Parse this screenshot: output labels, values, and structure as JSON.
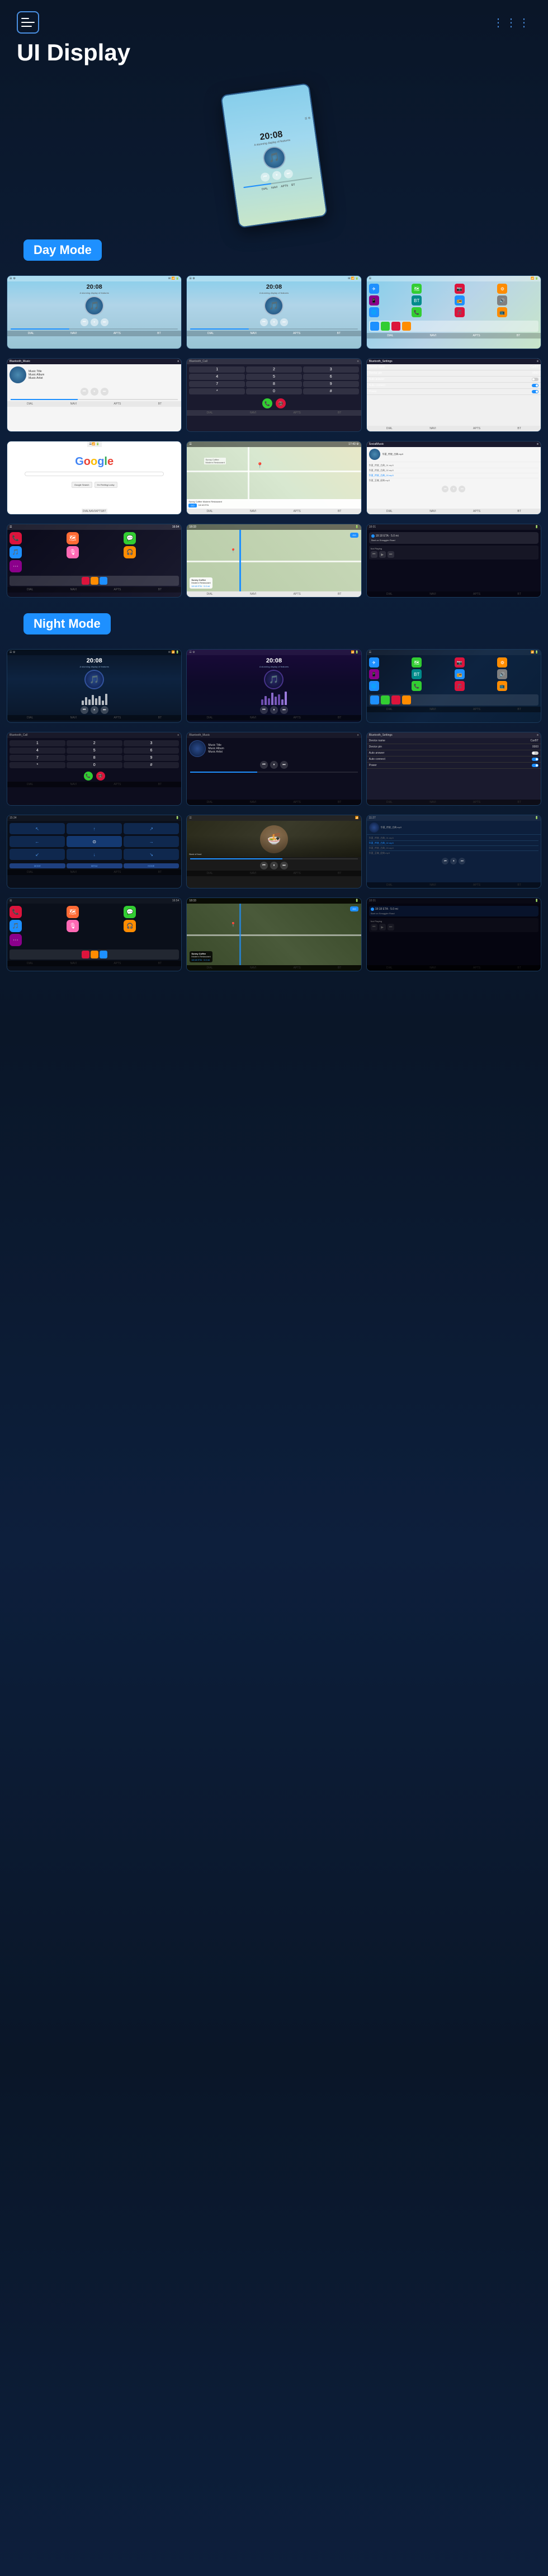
{
  "header": {
    "title": "UI Display",
    "menu_icon": "☰",
    "dots_icon": "⋮⋮"
  },
  "hero": {
    "time": "20:08",
    "subtitle": "A stunning display of features"
  },
  "day_mode": {
    "label": "Day Mode",
    "screens": [
      {
        "type": "music_player",
        "time": "20:08",
        "subtitle": "A stunning display of features",
        "track": "Music Title",
        "artist": "Music Artist",
        "album": "Music Album",
        "mode": "day"
      },
      {
        "type": "music_player",
        "time": "20:08",
        "subtitle": "A stunning display of features",
        "mode": "day"
      },
      {
        "type": "app_grid",
        "mode": "day"
      },
      {
        "type": "bluetooth_music",
        "label": "Bluetooth_Music",
        "track": "Music Title",
        "album": "Music Album",
        "artist": "Music Artist",
        "mode": "day"
      },
      {
        "type": "bluetooth_call",
        "label": "Bluetooth_Call",
        "mode": "day"
      },
      {
        "type": "bluetooth_settings",
        "label": "Bluetooth_Settings",
        "device_name": "CarBT",
        "device_pin": "0000",
        "mode": "day"
      },
      {
        "type": "google",
        "mode": "day"
      },
      {
        "type": "navigation",
        "restaurant": "Sunny Coffee Modern Restaurant",
        "mode": "day"
      },
      {
        "type": "local_music",
        "label": "SocialMusic",
        "mode": "day"
      }
    ]
  },
  "carplay": {
    "screens": [
      {
        "type": "phone_app",
        "mode": "carplay"
      },
      {
        "type": "map_nav",
        "mode": "carplay"
      },
      {
        "type": "not_playing",
        "road": "Smuggler Road",
        "mode": "carplay"
      }
    ]
  },
  "night_mode": {
    "label": "Night Mode",
    "screens": [
      {
        "type": "music_player",
        "time": "20:08",
        "mode": "night"
      },
      {
        "type": "music_player",
        "time": "20:08",
        "mode": "night2"
      },
      {
        "type": "app_grid",
        "mode": "night"
      },
      {
        "type": "bluetooth_call",
        "label": "Bluetooth_Call",
        "mode": "night"
      },
      {
        "type": "bluetooth_music",
        "label": "Bluetooth_Music",
        "track": "Music Title",
        "album": "Music Album",
        "artist": "Music Artist",
        "mode": "night"
      },
      {
        "type": "bluetooth_settings",
        "label": "Bluetooth_Settings",
        "device_name": "CarBT",
        "device_pin": "0000",
        "mode": "night"
      },
      {
        "type": "equalizer",
        "mode": "night"
      },
      {
        "type": "video_thumb",
        "mode": "night"
      },
      {
        "type": "local_music_dark",
        "mode": "night"
      }
    ]
  },
  "carplay_night": {
    "screens": [
      {
        "type": "phone_app_night",
        "mode": "night_carplay"
      },
      {
        "type": "map_nav_night",
        "restaurant": "Sunny Coffee Modern Restaurant",
        "mode": "night_carplay"
      },
      {
        "type": "not_playing_night",
        "road": "Smuggler Road",
        "mode": "night_carplay"
      }
    ]
  },
  "bottom_bar_labels": [
    "DIAL",
    "NAVI",
    "APTS",
    "BT"
  ],
  "wave_heights": [
    4,
    7,
    5,
    9,
    6,
    8,
    4,
    11,
    7,
    5,
    9,
    6,
    8,
    4,
    7,
    5,
    9,
    6
  ],
  "eq_heights_day": [
    8,
    14,
    10,
    18,
    12,
    16,
    8,
    20,
    14,
    10,
    18,
    12
  ],
  "eq_heights_night": [
    10,
    16,
    12,
    22,
    15,
    19,
    10,
    24,
    16,
    12,
    20,
    14
  ],
  "settings_items": [
    {
      "label": "Device name",
      "value": "CarBT"
    },
    {
      "label": "Device pin",
      "value": "0000"
    },
    {
      "label": "Auto answer",
      "toggle": "off"
    },
    {
      "label": "Auto connect",
      "toggle": "on"
    },
    {
      "label": "Power",
      "toggle": "on"
    }
  ],
  "music_text": {
    "title": "Music Title",
    "album": "Music Album",
    "artist": "Music Artist"
  }
}
